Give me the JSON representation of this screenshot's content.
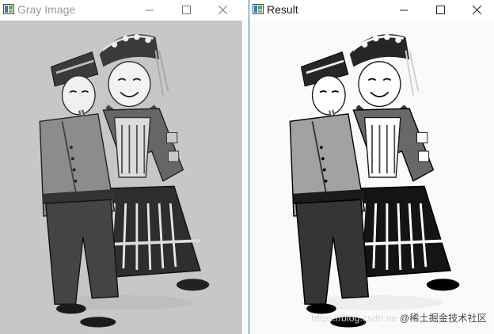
{
  "windows": [
    {
      "title": "Gray Image",
      "controls": {
        "minimize": "—",
        "maximize": "☐",
        "close": "✕"
      }
    },
    {
      "title": "Result",
      "controls": {
        "minimize": "—",
        "maximize": "☐",
        "close": "✕"
      }
    }
  ],
  "watermark": {
    "url": "https://blog.csdn.ne",
    "site": "@稀土掘金技术社区"
  },
  "icons": {
    "app": "opencv-window-icon",
    "minimize": "minimize-icon",
    "maximize": "maximize-icon",
    "close": "close-icon"
  }
}
